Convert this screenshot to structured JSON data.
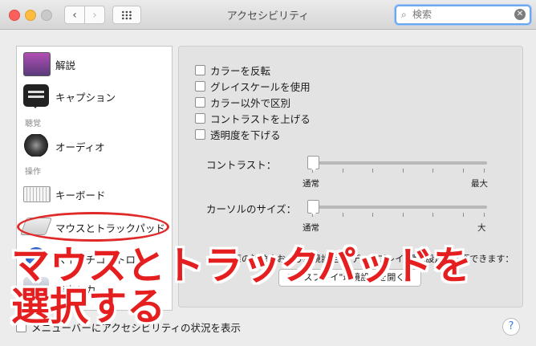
{
  "window": {
    "title": "アクセシビリティ",
    "search_placeholder": "検索"
  },
  "sidebar": {
    "items": [
      {
        "label": "解説",
        "icon": "display-icon"
      },
      {
        "label": "キャプション",
        "icon": "caption-icon"
      },
      {
        "label": "オーディオ",
        "icon": "speaker-icon"
      },
      {
        "label": "キーボード",
        "icon": "keyboard-icon"
      },
      {
        "label": "マウスとトラックパッド",
        "icon": "trackpad-icon"
      },
      {
        "label": "スイッチコントロール",
        "icon": "switch-control-icon"
      },
      {
        "label": "音声入力",
        "icon": "dictation-icon"
      }
    ],
    "sections": {
      "hearing": "聴覚",
      "interaction": "操作"
    }
  },
  "options": {
    "checkboxes": [
      {
        "label": "カラーを反転",
        "checked": false
      },
      {
        "label": "グレイスケールを使用",
        "checked": false
      },
      {
        "label": "カラー以外で区別",
        "checked": false
      },
      {
        "label": "コントラストを上げる",
        "checked": false
      },
      {
        "label": "透明度を下げる",
        "checked": false
      }
    ],
    "contrast": {
      "label": "コントラスト：",
      "min_label": "通常",
      "max_label": "最大",
      "value": 0
    },
    "cursor_size": {
      "label": "カーソルのサイズ：",
      "min_label": "通常",
      "max_label": "大",
      "value": 0
    },
    "display_note": "画面の解像度および環境設定は\"ディスプレイ\"環境設定で変更できます：",
    "display_button": "ディスプレイ\"環境設定を開く..."
  },
  "footer": {
    "menubar_checkbox": "メニューバーにアクセシビリティの状況を表示",
    "help": "?"
  },
  "overlay": {
    "line1": "マウスとトラックパッドを",
    "line2": "選択する"
  },
  "colors": {
    "annotation_red": "#e51f1f",
    "search_focus": "#6aa8f0"
  }
}
